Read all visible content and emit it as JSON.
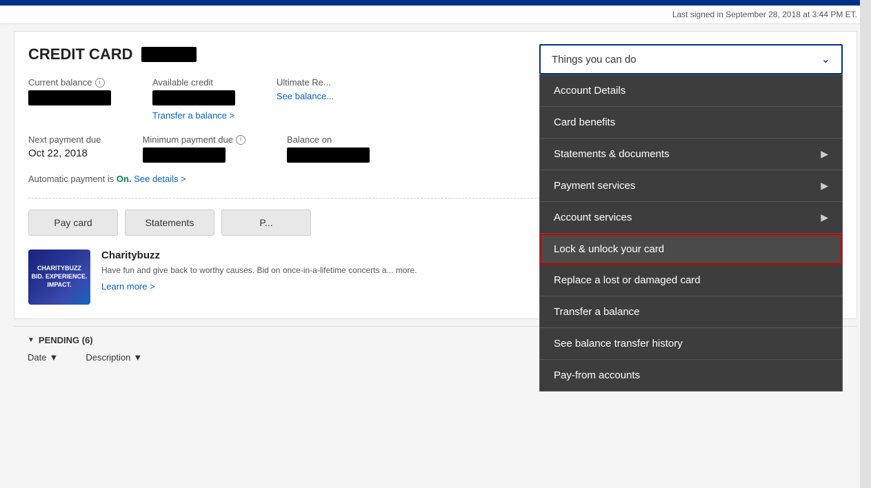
{
  "header": {
    "last_signed_in": "Last signed in September 28, 2018 at 3:44 PM ET."
  },
  "page": {
    "title": "CREDIT CARD"
  },
  "account": {
    "current_balance_label": "Current balance",
    "available_credit_label": "Available credit",
    "ultimate_rewards_label": "Ultimate Re...",
    "see_balance_link": "See balance...",
    "transfer_balance_link": "Transfer a balance >",
    "next_payment_label": "Next payment due",
    "next_payment_value": "Oct 22, 2018",
    "minimum_payment_label": "Minimum payment due",
    "balance_on_label": "Balance on",
    "auto_payment_prefix": "Automatic payment is",
    "auto_payment_status": "On.",
    "auto_payment_link": "See details >"
  },
  "buttons": {
    "pay_card": "Pay card",
    "statements": "Statements",
    "third_btn": "P..."
  },
  "promo": {
    "title": "Charitybuzz",
    "description": "Have fun and give back to worthy causes. Bid on once-in-a-lifetime concerts a... more.",
    "learn_link": "Learn more >"
  },
  "pending": {
    "header": "PENDING (6)",
    "col_date": "Date",
    "col_description": "Description"
  },
  "dropdown": {
    "trigger_label": "Things you can do",
    "items": [
      {
        "id": "account-details",
        "label": "Account Details",
        "has_arrow": false,
        "highlighted": false
      },
      {
        "id": "card-benefits",
        "label": "Card benefits",
        "has_arrow": false,
        "highlighted": false
      },
      {
        "id": "statements-docs",
        "label": "Statements & documents",
        "has_arrow": true,
        "highlighted": false
      },
      {
        "id": "payment-services",
        "label": "Payment services",
        "has_arrow": true,
        "highlighted": false
      },
      {
        "id": "account-services",
        "label": "Account services",
        "has_arrow": true,
        "highlighted": false
      },
      {
        "id": "lock-unlock",
        "label": "Lock & unlock your card",
        "has_arrow": false,
        "highlighted": true
      },
      {
        "id": "replace-card",
        "label": "Replace a lost or damaged card",
        "has_arrow": false,
        "highlighted": false
      },
      {
        "id": "transfer-balance",
        "label": "Transfer a balance",
        "has_arrow": false,
        "highlighted": false
      },
      {
        "id": "balance-history",
        "label": "See balance transfer history",
        "has_arrow": false,
        "highlighted": false
      },
      {
        "id": "pay-from",
        "label": "Pay-from accounts",
        "has_arrow": false,
        "highlighted": false
      }
    ]
  }
}
